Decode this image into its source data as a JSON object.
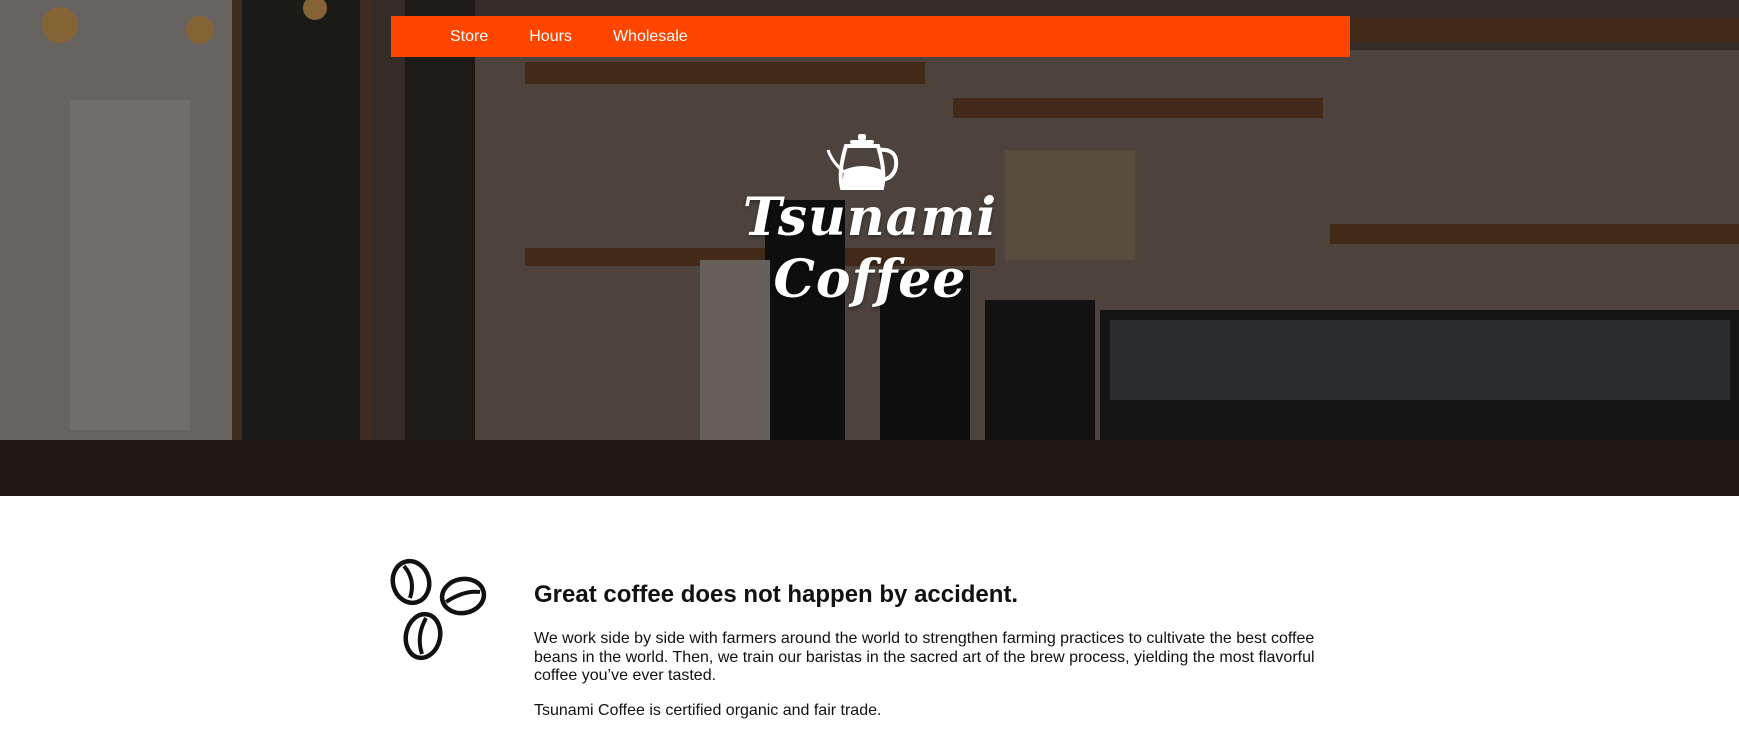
{
  "nav": {
    "items": [
      {
        "label": "Store"
      },
      {
        "label": "Hours"
      },
      {
        "label": "Wholesale"
      }
    ],
    "background_color": "#ff4500"
  },
  "hero": {
    "brand_line1": "Tsunami",
    "brand_line2": "Coffee",
    "logo_icon": "kettle-icon"
  },
  "content": {
    "icon": "coffee-beans-icon",
    "heading": "Great coffee does not happen by accident.",
    "paragraph1": "We work side by side with farmers around the world to strengthen farming practices to cultivate the best coffee beans in the world. Then, we train our baristas in the sacred art of the brew process, yielding the most flavorful coffee you’ve ever tasted.",
    "paragraph2": "Tsunami Coffee is certified organic and fair trade."
  }
}
